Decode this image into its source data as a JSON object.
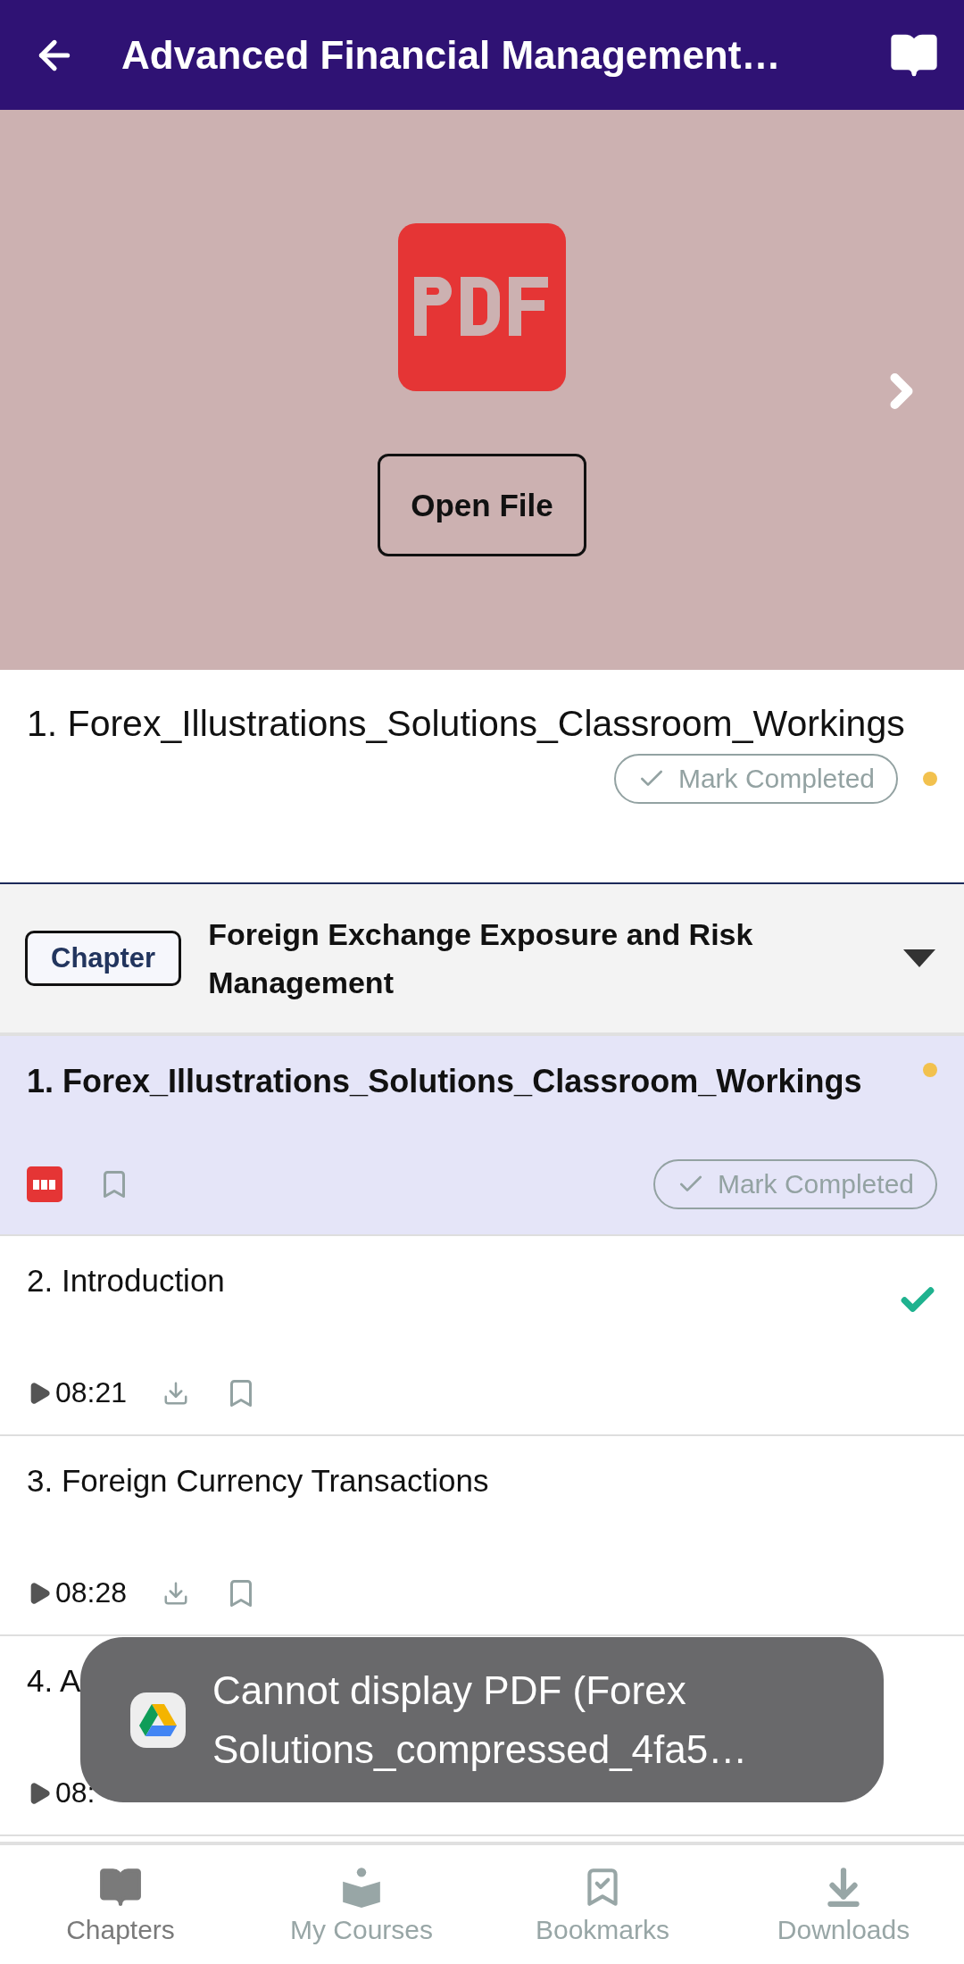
{
  "header": {
    "title": "Advanced Financial Management…"
  },
  "viewer": {
    "button": "Open File"
  },
  "current": {
    "title": "1. Forex_Illustrations_Solutions_Classroom_Workings",
    "mark_button": "Mark Completed",
    "started": true
  },
  "chapter": {
    "badge": "Chapter",
    "title": "Foreign Exchange Exposure and Risk Management",
    "expanded": true
  },
  "items": [
    {
      "kind": "pdf",
      "title": "1. Forex_Illustrations_Solutions_Classroom_Workings",
      "selected": true,
      "started": true,
      "completed": false,
      "mark_button": "Mark Completed"
    },
    {
      "kind": "video",
      "title": "2. Introduction",
      "duration": "08:21",
      "selected": false,
      "started": false,
      "completed": true
    },
    {
      "kind": "video",
      "title": "3. Foreign Currency Transactions",
      "duration": "08:28",
      "selected": false,
      "started": false,
      "completed": false
    },
    {
      "kind": "video",
      "title": "4. A",
      "duration": "08:",
      "selected": false
    }
  ],
  "toast": {
    "text": "Cannot display PDF (Forex Solutions_compressed_4fa5…"
  },
  "nav": [
    {
      "label": "Chapters",
      "selected": true
    },
    {
      "label": "My Courses",
      "selected": false
    },
    {
      "label": "Bookmarks",
      "selected": false
    },
    {
      "label": "Downloads",
      "selected": false
    }
  ]
}
